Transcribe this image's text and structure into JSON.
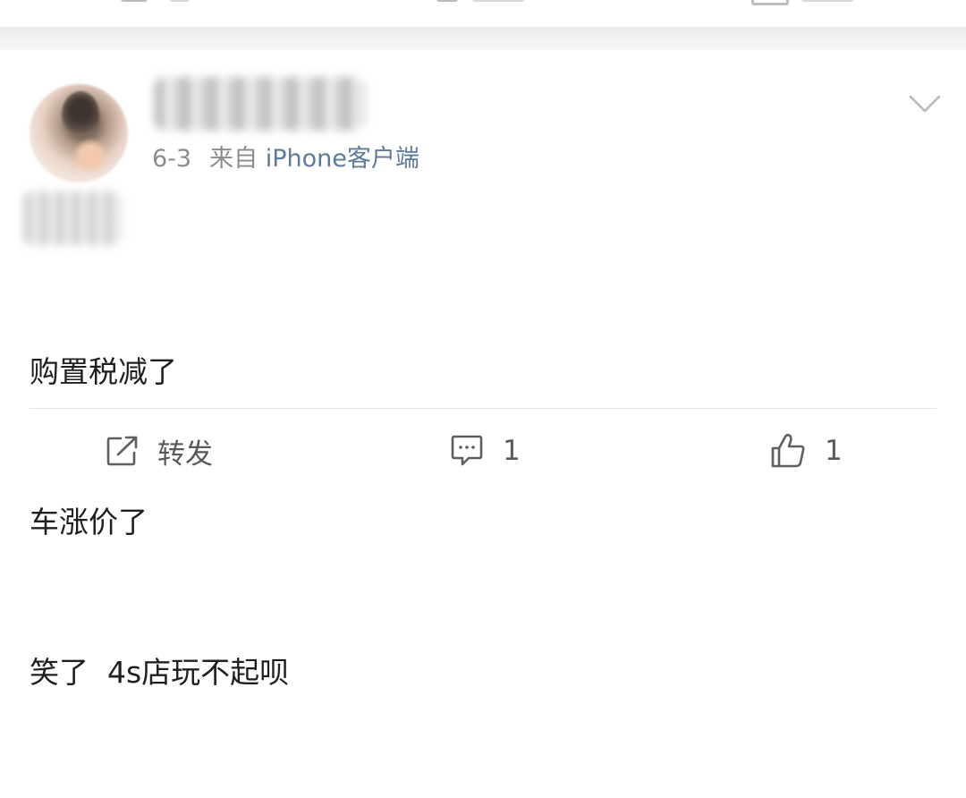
{
  "post": {
    "date": "6-3",
    "source_prefix": "来自",
    "source_name": "iPhone客户端",
    "content_lines": [
      "购置税减了",
      "车涨价了",
      "笑了  4s店玩不起呗"
    ]
  },
  "actions": {
    "repost_label": "转发",
    "comment_count": "1",
    "like_count": "1"
  },
  "icons": {
    "menu": "chevron-down-icon",
    "repost": "share-icon",
    "comment": "comment-icon",
    "like": "thumbs-up-icon"
  },
  "colors": {
    "meta_text": "#8c8c8c",
    "source_text": "#5d7a9c",
    "content_text": "#1f1f1f",
    "action_text": "#595959",
    "separator": "#efefef"
  }
}
